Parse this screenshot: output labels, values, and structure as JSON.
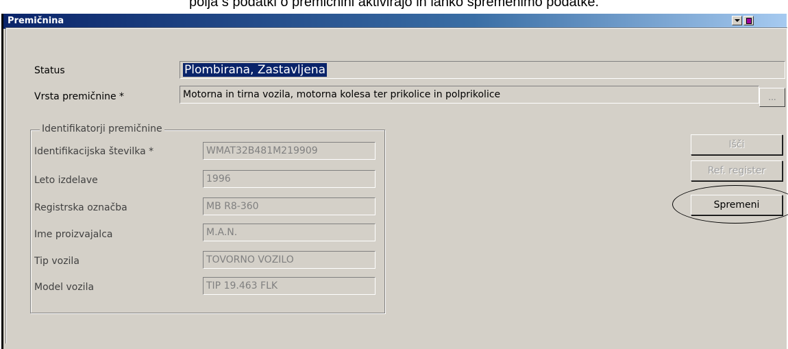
{
  "caption": "polja s podatki o premičnini aktivirajo in lahko spremenimo podatke.",
  "window": {
    "title": "Premičnina"
  },
  "form": {
    "status_label": "Status",
    "status_value": "Plombirana, Zastavljena",
    "vrsta_label": "Vrsta premičnine *",
    "vrsta_value": "Motorna in tirna vozila, motorna kolesa ter prikolice in polprikolice",
    "browse_label": "..."
  },
  "group": {
    "title": "Identifikatorji premičnine",
    "fields": [
      {
        "label": "Identifikacijska številka *",
        "value": "WMAT32B481M219909"
      },
      {
        "label": "Leto izdelave",
        "value": "1996"
      },
      {
        "label": "Registrska označba",
        "value": "MB R8-360"
      },
      {
        "label": "Ime proizvajalca",
        "value": "M.A.N."
      },
      {
        "label": "Tip vozila",
        "value": "TOVORNO VOZILO"
      },
      {
        "label": "Model vozila",
        "value": "TIP 19.463 FLK"
      }
    ]
  },
  "buttons": {
    "isci": "Išči",
    "ref_register": "Ref. register",
    "spremeni": "Spremeni"
  },
  "colors": {
    "selection": "#0a246a",
    "window_bg": "#d4d0c8"
  }
}
